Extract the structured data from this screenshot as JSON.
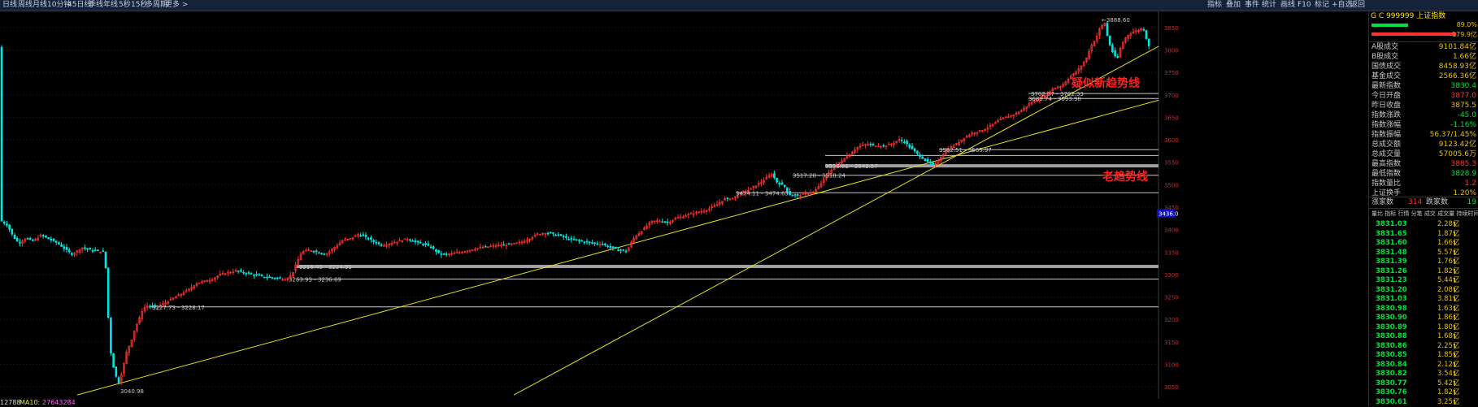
{
  "toolbar": {
    "left_tabs": [
      "日线",
      "周线",
      "月线",
      "10分钟",
      "45日线",
      "季线",
      "年线",
      "5秒",
      "15秒",
      "多周期",
      "更多 >"
    ],
    "right_tabs": [
      "指标",
      "叠加",
      "事件",
      "统计",
      "画线",
      "F10",
      "标记",
      "+自选",
      "返回"
    ]
  },
  "chart_data": {
    "type": "candlestick",
    "instrument": "上证指数",
    "y_axis_ticks": [
      3850,
      3800,
      3750,
      3700,
      3650,
      3600,
      3550,
      3500,
      3450,
      3400,
      3350,
      3300,
      3250,
      3200,
      3150,
      3100,
      3050
    ],
    "ylim": [
      3025,
      3875
    ],
    "crosshair_price": "3436.0",
    "peak_label": "3888.60",
    "low_label": "3040.98",
    "close_path": [
      [
        0,
        3420
      ],
      [
        8,
        3410
      ],
      [
        15,
        3385
      ],
      [
        22,
        3370
      ],
      [
        30,
        3380
      ],
      [
        40,
        3375
      ],
      [
        50,
        3388
      ],
      [
        60,
        3378
      ],
      [
        70,
        3370
      ],
      [
        80,
        3355
      ],
      [
        88,
        3345
      ],
      [
        100,
        3360
      ],
      [
        110,
        3355
      ],
      [
        120,
        3352
      ],
      [
        128,
        3350
      ],
      [
        132,
        3210
      ],
      [
        135,
        3130
      ],
      [
        140,
        3080
      ],
      [
        145,
        3060
      ],
      [
        150,
        3090
      ],
      [
        155,
        3130
      ],
      [
        160,
        3150
      ],
      [
        165,
        3180
      ],
      [
        170,
        3200
      ],
      [
        175,
        3225
      ],
      [
        180,
        3230
      ],
      [
        190,
        3228
      ],
      [
        200,
        3235
      ],
      [
        210,
        3245
      ],
      [
        220,
        3255
      ],
      [
        230,
        3265
      ],
      [
        240,
        3280
      ],
      [
        250,
        3285
      ],
      [
        260,
        3290
      ],
      [
        270,
        3300
      ],
      [
        280,
        3305
      ],
      [
        290,
        3308
      ],
      [
        300,
        3304
      ],
      [
        310,
        3300
      ],
      [
        320,
        3296
      ],
      [
        330,
        3294
      ],
      [
        340,
        3292
      ],
      [
        350,
        3290
      ],
      [
        358,
        3300
      ],
      [
        365,
        3330
      ],
      [
        370,
        3350
      ],
      [
        380,
        3355
      ],
      [
        390,
        3350
      ],
      [
        400,
        3345
      ],
      [
        410,
        3360
      ],
      [
        420,
        3375
      ],
      [
        430,
        3380
      ],
      [
        440,
        3390
      ],
      [
        450,
        3382
      ],
      [
        460,
        3372
      ],
      [
        470,
        3365
      ],
      [
        480,
        3370
      ],
      [
        490,
        3375
      ],
      [
        500,
        3380
      ],
      [
        510,
        3372
      ],
      [
        520,
        3368
      ],
      [
        530,
        3360
      ],
      [
        540,
        3345
      ],
      [
        550,
        3345
      ],
      [
        560,
        3348
      ],
      [
        570,
        3352
      ],
      [
        580,
        3356
      ],
      [
        590,
        3360
      ],
      [
        600,
        3362
      ],
      [
        610,
        3365
      ],
      [
        620,
        3366
      ],
      [
        630,
        3368
      ],
      [
        640,
        3372
      ],
      [
        650,
        3380
      ],
      [
        660,
        3390
      ],
      [
        670,
        3393
      ],
      [
        680,
        3390
      ],
      [
        690,
        3385
      ],
      [
        700,
        3378
      ],
      [
        710,
        3376
      ],
      [
        720,
        3372
      ],
      [
        730,
        3370
      ],
      [
        740,
        3368
      ],
      [
        750,
        3360
      ],
      [
        760,
        3355
      ],
      [
        770,
        3352
      ],
      [
        775,
        3370
      ],
      [
        780,
        3385
      ],
      [
        790,
        3400
      ],
      [
        800,
        3418
      ],
      [
        810,
        3420
      ],
      [
        820,
        3416
      ],
      [
        830,
        3425
      ],
      [
        840,
        3430
      ],
      [
        850,
        3436
      ],
      [
        860,
        3440
      ],
      [
        870,
        3445
      ],
      [
        880,
        3455
      ],
      [
        890,
        3468
      ],
      [
        900,
        3470
      ],
      [
        910,
        3480
      ],
      [
        920,
        3488
      ],
      [
        930,
        3500
      ],
      [
        940,
        3512
      ],
      [
        948,
        3525
      ],
      [
        955,
        3505
      ],
      [
        965,
        3495
      ],
      [
        970,
        3478
      ],
      [
        980,
        3476
      ],
      [
        990,
        3480
      ],
      [
        1000,
        3484
      ],
      [
        1008,
        3500
      ],
      [
        1015,
        3520
      ],
      [
        1025,
        3540
      ],
      [
        1035,
        3555
      ],
      [
        1045,
        3570
      ],
      [
        1055,
        3585
      ],
      [
        1065,
        3590
      ],
      [
        1075,
        3588
      ],
      [
        1085,
        3586
      ],
      [
        1095,
        3590
      ],
      [
        1105,
        3600
      ],
      [
        1112,
        3595
      ],
      [
        1120,
        3580
      ],
      [
        1130,
        3565
      ],
      [
        1140,
        3550
      ],
      [
        1148,
        3542
      ],
      [
        1155,
        3560
      ],
      [
        1165,
        3580
      ],
      [
        1175,
        3590
      ],
      [
        1185,
        3605
      ],
      [
        1195,
        3615
      ],
      [
        1205,
        3620
      ],
      [
        1215,
        3628
      ],
      [
        1225,
        3640
      ],
      [
        1235,
        3650
      ],
      [
        1245,
        3655
      ],
      [
        1255,
        3665
      ],
      [
        1265,
        3680
      ],
      [
        1275,
        3690
      ],
      [
        1285,
        3700
      ],
      [
        1295,
        3715
      ],
      [
        1305,
        3720
      ],
      [
        1315,
        3740
      ],
      [
        1325,
        3755
      ],
      [
        1335,
        3780
      ],
      [
        1340,
        3805
      ],
      [
        1348,
        3830
      ],
      [
        1352,
        3850
      ],
      [
        1358,
        3860
      ],
      [
        1362,
        3822
      ],
      [
        1368,
        3793
      ],
      [
        1373,
        3778
      ],
      [
        1378,
        3810
      ],
      [
        1385,
        3832
      ],
      [
        1392,
        3840
      ],
      [
        1398,
        3843
      ],
      [
        1405,
        3850
      ],
      [
        1410,
        3820
      ],
      [
        1413,
        3806
      ]
    ]
  },
  "annotations": {
    "new_trend": "疑似新趋势线",
    "old_trend": "老趋势线",
    "range_labels": [
      "3040.98",
      "3227.73 - 3228.17",
      "3216.45 - 3224.91",
      "3263.93 - 3236.69",
      "3474.11 - 3474.63",
      "3517.28 - 3518.24",
      "3536.01 - 3542.57",
      "3562.51 - 3565.97",
      "3689.74 - 3693.98",
      "3702.07 - 3702.33"
    ]
  },
  "status_bar": {
    "left": "12788",
    "mavol_label": "MA10:",
    "mavol_value": "27643284"
  },
  "right_panel": {
    "header": "G  C  999999  上证指数",
    "top_values": [
      "89.0%",
      "179.9亿"
    ],
    "stats": [
      {
        "label": "A股成交",
        "value": "9101.84亿"
      },
      {
        "label": "B股成交",
        "value": "1.66亿"
      },
      {
        "label": "国债成交",
        "value": "8458.93亿"
      },
      {
        "label": "基金成交",
        "value": "2566.36亿"
      },
      {
        "label": "最新指数",
        "value": "3830.4"
      },
      {
        "label": "今日开盘",
        "value": "3877.0"
      },
      {
        "label": "昨日收盘",
        "value": "3875.5"
      },
      {
        "label": "指数涨跌",
        "value": "-45.0"
      },
      {
        "label": "指数涨幅",
        "value": "-1.16%"
      },
      {
        "label": "指数振幅",
        "value": "56.37/1.45%"
      },
      {
        "label": "总成交额",
        "value": "9123.42亿"
      },
      {
        "label": "总成交量",
        "value": "57005.6万"
      },
      {
        "label": "最高指数",
        "value": "3885.3"
      },
      {
        "label": "最低指数",
        "value": "3828.9"
      },
      {
        "label": "指数量比",
        "value": "1.2"
      },
      {
        "label": "上证换手",
        "value": "1.20%"
      }
    ],
    "up_label": "涨家数",
    "up_value": "314",
    "down_label": "跌家数",
    "down_value": "19",
    "mini_header": "量比 指标 行情 分笔 成交 成交量 持续时间",
    "ticks": [
      {
        "price": "3831.03",
        "amount": "2.28亿"
      },
      {
        "price": "3831.65",
        "amount": "1.87亿"
      },
      {
        "price": "3831.60",
        "amount": "1.66亿"
      },
      {
        "price": "3831.48",
        "amount": "5.57亿"
      },
      {
        "price": "3831.39",
        "amount": "1.76亿"
      },
      {
        "price": "3831.26",
        "amount": "1.82亿"
      },
      {
        "price": "3831.23",
        "amount": "5.44亿"
      },
      {
        "price": "3831.20",
        "amount": "2.08亿"
      },
      {
        "price": "3831.03",
        "amount": "3.81亿"
      },
      {
        "price": "3830.98",
        "amount": "1.63亿"
      },
      {
        "price": "3830.90",
        "amount": "1.86亿"
      },
      {
        "price": "3830.89",
        "amount": "1.80亿"
      },
      {
        "price": "3830.88",
        "amount": "1.68亿"
      },
      {
        "price": "3830.86",
        "amount": "2.25亿"
      },
      {
        "price": "3830.85",
        "amount": "1.85亿"
      },
      {
        "price": "3830.84",
        "amount": "2.12亿"
      },
      {
        "price": "3830.82",
        "amount": "3.54亿"
      },
      {
        "price": "3830.77",
        "amount": "5.42亿"
      },
      {
        "price": "3830.76",
        "amount": "1.82亿"
      },
      {
        "price": "3830.61",
        "amount": "3.25亿"
      }
    ]
  },
  "colors": {
    "up": "#ff3030",
    "down": "#00e5e5",
    "trend": "#e0e020",
    "annotation": "#ff2020",
    "value": "#e8c000",
    "tick_price": "#00e040"
  }
}
